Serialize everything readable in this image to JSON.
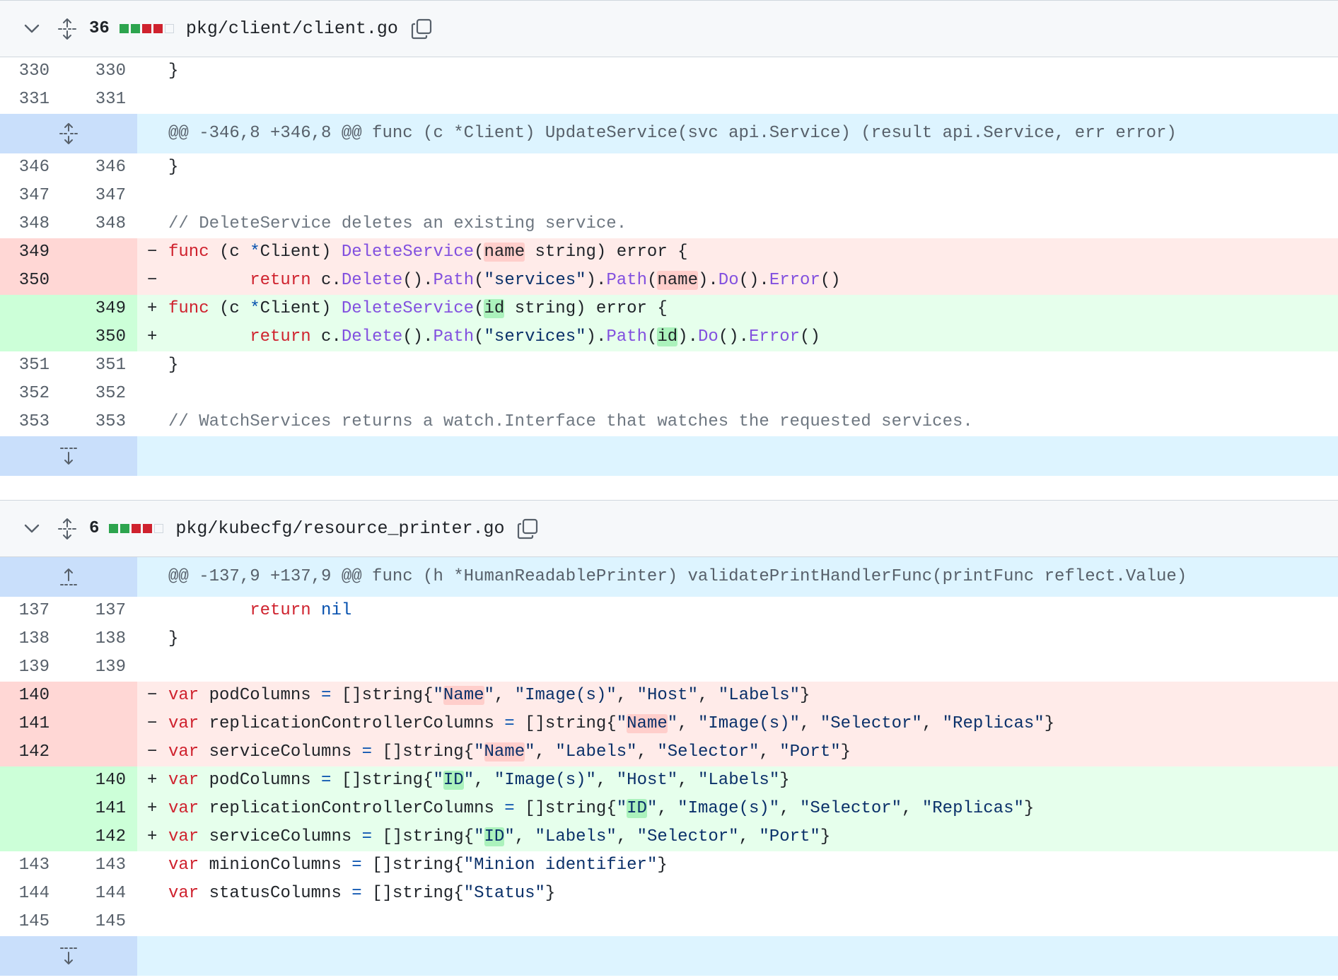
{
  "files": [
    {
      "count": "36",
      "path": "pkg/client/client.go",
      "diffstat": [
        "add",
        "add",
        "del",
        "del",
        "neutral"
      ],
      "top_rows": [
        {
          "type": "ctx",
          "old": "330",
          "new": "330",
          "text": "}"
        },
        {
          "type": "ctx",
          "old": "331",
          "new": "331",
          "text": ""
        }
      ],
      "hunk_header": "@@ -346,8 +346,8 @@ func (c *Client) UpdateService(svc api.Service) (result api.Service, err error)",
      "rows": [
        {
          "type": "ctx",
          "old": "346",
          "new": "346",
          "text": "}"
        },
        {
          "type": "ctx",
          "old": "347",
          "new": "347",
          "text": ""
        },
        {
          "type": "ctx",
          "old": "348",
          "new": "348",
          "text": "// DeleteService deletes an existing service."
        },
        {
          "type": "del",
          "old": "349",
          "new": "",
          "text": "func (c *Client) DeleteService(name string) error {"
        },
        {
          "type": "del",
          "old": "350",
          "new": "",
          "text": "        return c.Delete().Path(\"services\").Path(name).Do().Error()"
        },
        {
          "type": "add",
          "old": "",
          "new": "349",
          "text": "func (c *Client) DeleteService(id string) error {"
        },
        {
          "type": "add",
          "old": "",
          "new": "350",
          "text": "        return c.Delete().Path(\"services\").Path(id).Do().Error()"
        },
        {
          "type": "ctx",
          "old": "351",
          "new": "351",
          "text": "}"
        },
        {
          "type": "ctx",
          "old": "352",
          "new": "352",
          "text": ""
        },
        {
          "type": "ctx",
          "old": "353",
          "new": "353",
          "text": "// WatchServices returns a watch.Interface that watches the requested services."
        }
      ]
    },
    {
      "count": "6",
      "path": "pkg/kubecfg/resource_printer.go",
      "diffstat": [
        "add",
        "add",
        "del",
        "del",
        "neutral"
      ],
      "hunk_header": "@@ -137,9 +137,9 @@ func (h *HumanReadablePrinter) validatePrintHandlerFunc(printFunc reflect.Value)",
      "rows": [
        {
          "type": "ctx",
          "old": "137",
          "new": "137",
          "text": "        return nil"
        },
        {
          "type": "ctx",
          "old": "138",
          "new": "138",
          "text": "}"
        },
        {
          "type": "ctx",
          "old": "139",
          "new": "139",
          "text": ""
        },
        {
          "type": "del",
          "old": "140",
          "new": "",
          "text": "var podColumns = []string{\"Name\", \"Image(s)\", \"Host\", \"Labels\"}"
        },
        {
          "type": "del",
          "old": "141",
          "new": "",
          "text": "var replicationControllerColumns = []string{\"Name\", \"Image(s)\", \"Selector\", \"Replicas\"}"
        },
        {
          "type": "del",
          "old": "142",
          "new": "",
          "text": "var serviceColumns = []string{\"Name\", \"Labels\", \"Selector\", \"Port\"}"
        },
        {
          "type": "add",
          "old": "",
          "new": "140",
          "text": "var podColumns = []string{\"ID\", \"Image(s)\", \"Host\", \"Labels\"}"
        },
        {
          "type": "add",
          "old": "",
          "new": "141",
          "text": "var replicationControllerColumns = []string{\"ID\", \"Image(s)\", \"Selector\", \"Replicas\"}"
        },
        {
          "type": "add",
          "old": "",
          "new": "142",
          "text": "var serviceColumns = []string{\"ID\", \"Labels\", \"Selector\", \"Port\"}"
        },
        {
          "type": "ctx",
          "old": "143",
          "new": "143",
          "text": "var minionColumns = []string{\"Minion identifier\"}"
        },
        {
          "type": "ctx",
          "old": "144",
          "new": "144",
          "text": "var statusColumns = []string{\"Status\"}"
        },
        {
          "type": "ctx",
          "old": "145",
          "new": "145",
          "text": ""
        }
      ]
    }
  ],
  "icons": {
    "collapse": "chevron-down-icon",
    "expand": "unfold-icon",
    "copy": "copy-icon",
    "expand_up": "expand-up-icon",
    "expand_down": "expand-down-icon"
  },
  "colors": {
    "added": "#2da44e",
    "deleted": "#cf222e",
    "neutral": "#d0d7de",
    "hunk_bg": "#ddf4ff",
    "hunk_gutter": "#c9dffb"
  }
}
